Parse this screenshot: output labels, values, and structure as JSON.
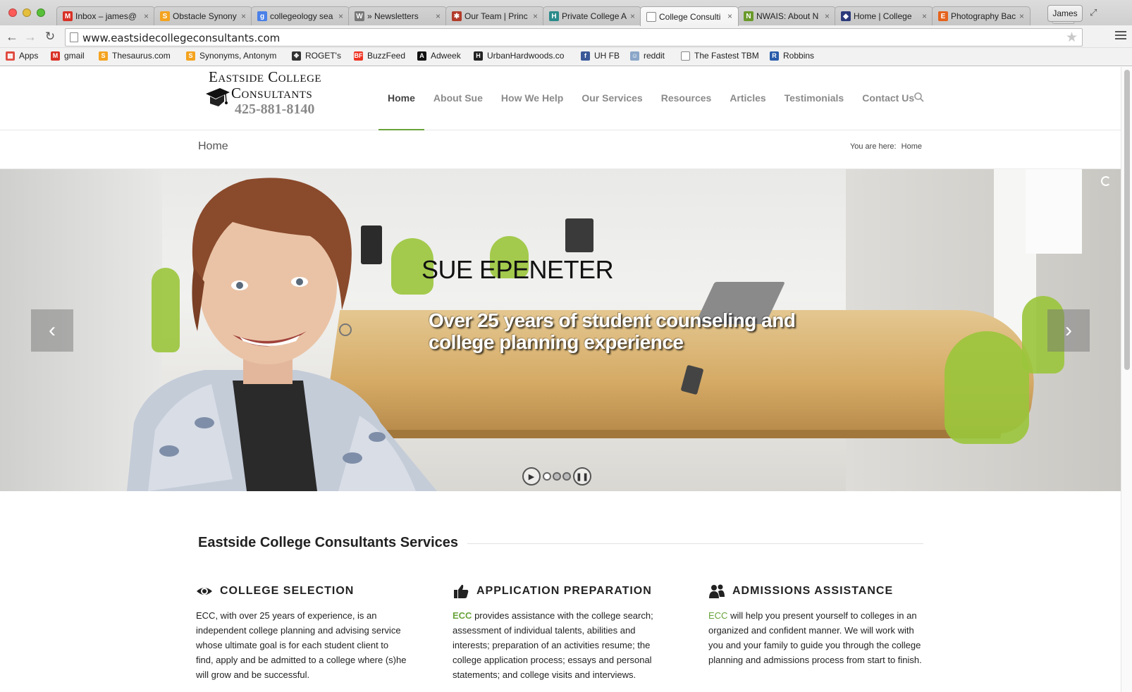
{
  "browser": {
    "tabs": [
      {
        "label": "Inbox – james@",
        "icon": "gmail-icon",
        "color": "#d93025",
        "glyph": "M"
      },
      {
        "label": "Obstacle Synony",
        "icon": "thesaurus-icon",
        "color": "#f4a31f",
        "glyph": "S"
      },
      {
        "label": "collegeology sea",
        "icon": "google-icon",
        "color": "#4a80e8",
        "glyph": "g"
      },
      {
        "label": "» Newsletters",
        "icon": "wordpress-icon",
        "color": "#777777",
        "glyph": "W"
      },
      {
        "label": "Our Team | Princ",
        "icon": "princeton-icon",
        "color": "#b23b2b",
        "glyph": "✱"
      },
      {
        "label": "Private College A",
        "icon": "h-icon",
        "color": "#2a8a8a",
        "glyph": "H"
      },
      {
        "label": "College Consulti",
        "icon": "page-icon",
        "color": "#ffffff",
        "glyph": ""
      },
      {
        "label": "NWAIS: About N",
        "icon": "nwais-icon",
        "color": "#6a9a2a",
        "glyph": "N"
      },
      {
        "label": "Home | College",
        "icon": "crest-icon",
        "color": "#2b3a7a",
        "glyph": "◆"
      },
      {
        "label": "Photography Bac",
        "icon": "etsy-icon",
        "color": "#e5631c",
        "glyph": "E"
      }
    ],
    "active_tab": 6,
    "profile": "James",
    "url": "www.eastsidecollegeconsultants.com",
    "bookmarks": [
      {
        "label": "Apps",
        "icon": "apps-grid-icon",
        "color": "#e04a3f",
        "glyph": "▦"
      },
      {
        "label": "gmail",
        "icon": "gmail-icon",
        "color": "#d93025",
        "glyph": "M"
      },
      {
        "label": "Thesaurus.com",
        "icon": "thesaurus-icon",
        "color": "#f4a31f",
        "glyph": "S"
      },
      {
        "label": "Synonyms, Antonym",
        "icon": "thesaurus-icon",
        "color": "#f4a31f",
        "glyph": "S"
      },
      {
        "label": "ROGET's",
        "icon": "roget-icon",
        "color": "#333333",
        "glyph": "✥"
      },
      {
        "label": "BuzzFeed",
        "icon": "buzzfeed-icon",
        "color": "#ee3322",
        "glyph": "BF"
      },
      {
        "label": "Adweek",
        "icon": "adweek-icon",
        "color": "#111111",
        "glyph": "A"
      },
      {
        "label": "UrbanHardwoods.co",
        "icon": "urbanhardwoods-icon",
        "color": "#222222",
        "glyph": "H"
      },
      {
        "label": "UH FB",
        "icon": "facebook-icon",
        "color": "#3b5998",
        "glyph": "f"
      },
      {
        "label": "reddit",
        "icon": "reddit-icon",
        "color": "#8aa6c8",
        "glyph": "☺"
      },
      {
        "label": "The Fastest TBM",
        "icon": "page-icon",
        "color": "#ffffff",
        "glyph": ""
      },
      {
        "label": "Robbins",
        "icon": "robbins-icon",
        "color": "#2a5caa",
        "glyph": "R"
      }
    ]
  },
  "site": {
    "logo": {
      "line1": "Eastside College",
      "line2": "Consultants",
      "phone": "425-881-8140"
    },
    "nav": [
      "Home",
      "About Sue",
      "How We Help",
      "Our Services",
      "Resources",
      "Articles",
      "Testimonials",
      "Contact Us"
    ],
    "nav_active": 0,
    "accent": "#6aa33a"
  },
  "titlebar": {
    "title": "Home",
    "breadcrumb_prefix": "You are here:",
    "breadcrumb_current": "Home"
  },
  "slider": {
    "name": "SUE EPENETER",
    "tagline": "Over 25 years of student counseling and college planning experience",
    "slides": 3,
    "current_slide": 1
  },
  "services": {
    "heading": "Eastside College Consultants Services",
    "columns": [
      {
        "title": "COLLEGE SELECTION",
        "icon": "eye-icon",
        "lead": "",
        "body": "ECC, with over 25 years of experience,  is an independent college planning and advising service whose ultimate goal is for each student client to find, apply and be admitted to a college where (s)he will grow and be successful."
      },
      {
        "title": "APPLICATION PREPARATION",
        "icon": "thumbs-up-icon",
        "lead": "ECC",
        "body": " provides assistance with the college search; assessment of individual talents, abilities and interests; preparation of an activities resume; the college application process; essays and personal statements; and college visits and interviews."
      },
      {
        "title": "ADMISSIONS ASSISTANCE",
        "icon": "users-icon",
        "lead": "ECC",
        "body": " will help you present yourself to colleges in an organized and confident manner. We will work with you and your family to guide you through the college planning and admissions process from start to finish."
      }
    ]
  }
}
